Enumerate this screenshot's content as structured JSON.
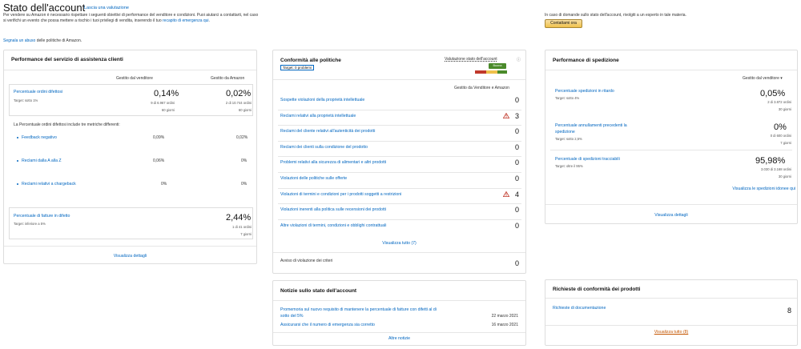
{
  "header": {
    "title": "Stato dell'account",
    "feedback_link": "Lascia una valutazione",
    "intro": "Per vendere su Amazon è necessario rispettare i seguenti obiettivi di performance del venditore e condizioni. Puoi aiutarci a contattarti, nel caso si verifichi un evento che possa mettere a rischio i tuoi privilegi di vendita, inserendo il tuo",
    "intro_link": "recapito di emergenza qui",
    "report_link": "Segnala un abuso",
    "report_text": "delle politiche di Amazon."
  },
  "contact": {
    "text": "In caso di domande sullo stato dell'account, rivolgiti a un esperto in tale materia.",
    "button": "Contattami ora"
  },
  "customer_service": {
    "title": "Performance del servizio di assistenza clienti",
    "col_seller": "Gestito dal venditore",
    "col_amazon": "Gestito da Amazon",
    "odr": {
      "label": "Percentuale ordini difettosi",
      "target": "Target: sotto 1%",
      "seller_value": "0,14%",
      "seller_orders": "9 di 6.967 ordini",
      "seller_days": "60 giorni",
      "amazon_value": "0,02%",
      "amazon_orders": "2 di 10.744 ordini",
      "amazon_days": "60 giorni"
    },
    "metrics_intro": "La Percentuale ordini difettosi include tre metriche differenti:",
    "metrics": [
      {
        "label": "Feedback negativo",
        "seller": "0,09%",
        "amazon": "0,02%"
      },
      {
        "label": "Reclami dalla A alla Z",
        "seller": "0,06%",
        "amazon": "0%"
      },
      {
        "label": "Reclami relativi a chargeback",
        "seller": "0%",
        "amazon": "0%"
      }
    ],
    "invoice": {
      "label": "Percentuale di fatture in difetto",
      "target": "Target: inferiore a 5%",
      "value": "2,44%",
      "orders": "1 di 41 ordini",
      "days": "7 giorni"
    },
    "details_link": "Visualizza dettagli"
  },
  "policy": {
    "title": "Conformità alle politiche",
    "rating_label": "Valutazione stato dell'account",
    "rating_badge": "Buona",
    "target_label": "Target: 0 problemi",
    "col_header": "Gestito da Venditore e Amazon",
    "rows": [
      {
        "label": "Sospette violazioni della proprietà intellettuale",
        "value": "0",
        "warn": false
      },
      {
        "label": "Reclami relativi alla proprietà intellettuale",
        "value": "3",
        "warn": true
      },
      {
        "label": "Reclami del cliente relativi all'autenticità dei prodotti",
        "value": "0",
        "warn": false
      },
      {
        "label": "Reclami dei clienti sulla condizione del prodotto",
        "value": "0",
        "warn": false
      },
      {
        "label": "Problemi relativi alla sicurezza di alimentari e altri prodotti",
        "value": "0",
        "warn": false
      },
      {
        "label": "Violazioni delle politiche sulle offerte",
        "value": "0",
        "warn": false
      },
      {
        "label": "Violazioni di termini e condizioni per i prodotti soggetti a restrizioni",
        "value": "4",
        "warn": true
      },
      {
        "label": "Violazioni inerenti alla politica sulle recensioni dei prodotti",
        "value": "0",
        "warn": false
      },
      {
        "label": "Altre violazioni di termini, condizioni e obblighi contrattuali",
        "value": "0",
        "warn": false
      }
    ],
    "view_all": "Visualizza tutto (7)",
    "notice_label": "Avviso di violazione dei criteri",
    "notice_value": "0"
  },
  "shipping": {
    "title": "Performance di spedizione",
    "dropdown": "Gestito dal venditore",
    "late": {
      "label": "Percentuale spedizioni in ritardo",
      "target": "Target: sotto 4%",
      "value": "0,05%",
      "orders": "2 di 3.872 ordini",
      "days": "30 giorni"
    },
    "cancel": {
      "label": "Percentuale annullamenti precedenti la spedizione",
      "target": "Target: sotto 2,5%",
      "value": "0%",
      "orders": "0 di 600 ordini",
      "days": "7 giorni"
    },
    "tracking": {
      "label": "Percentuale di spedizioni tracciabili",
      "target": "Target: oltre il 95%",
      "value": "95,98%",
      "orders": "3.030 di 3.168 ordini",
      "days": "30 giorni"
    },
    "eligible_link": "Visualizza le spedizioni idonee qui",
    "details_link": "Visualizza dettagli"
  },
  "news": {
    "title": "Notizie sullo stato dell'account",
    "items": [
      {
        "label": "Promemoria sul nuovo requisito di mantenere la percentuale di fatture con difetti al di sotto del 5%",
        "date": "22 marzo 2021"
      },
      {
        "label": "Assicurarsi che il numero di emergenza sia corretto",
        "date": "16 marzo 2021"
      }
    ],
    "more_link": "Altre notizie"
  },
  "compliance": {
    "title": "Richieste di conformità dei prodotti",
    "doc_label": "Richieste di documentazione",
    "doc_value": "8",
    "view_all": "Visualizza tutto (8)"
  }
}
